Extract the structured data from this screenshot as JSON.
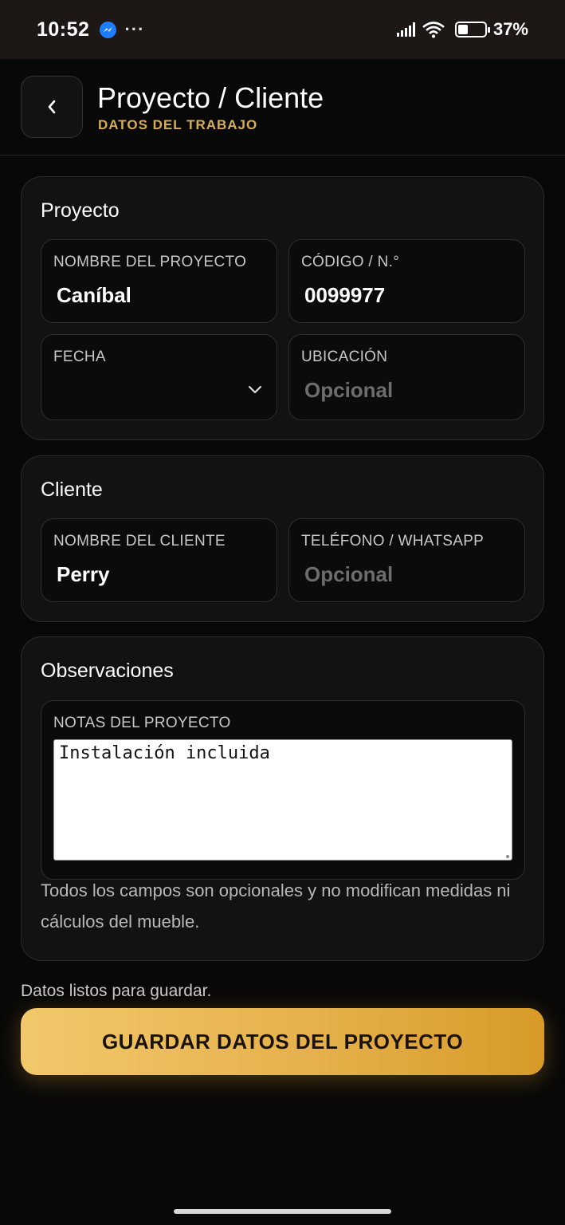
{
  "status_bar": {
    "time": "10:52",
    "battery_text": "37%",
    "battery_level": 0.37,
    "icons": [
      "messenger-icon",
      "more-dots-icon",
      "signal-icon",
      "wifi-icon",
      "battery-icon"
    ]
  },
  "header": {
    "title": "Proyecto / Cliente",
    "subtitle": "DATOS DEL TRABAJO",
    "back_icon": "chevron-left-icon"
  },
  "proyecto": {
    "section_title": "Proyecto",
    "nombre": {
      "label": "NOMBRE DEL PROYECTO",
      "value": "Caníbal"
    },
    "codigo": {
      "label": "CÓDIGO / N.°",
      "value": "0099977"
    },
    "fecha": {
      "label": "FECHA",
      "value": ""
    },
    "ubicacion": {
      "label": "UBICACIÓN",
      "placeholder": "Opcional"
    }
  },
  "cliente": {
    "section_title": "Cliente",
    "nombre": {
      "label": "NOMBRE DEL CLIENTE",
      "value": "Perry"
    },
    "telefono": {
      "label": "TELÉFONO / WHATSAPP",
      "placeholder": "Opcional"
    }
  },
  "observaciones": {
    "section_title": "Observaciones",
    "notas": {
      "label": "NOTAS DEL PROYECTO",
      "value": "Instalación incluida"
    },
    "helper": "Todos los campos son opcionales y no modifican medidas ni cálculos del mueble."
  },
  "footer": {
    "status": "Datos listos para guardar.",
    "save_label": "GUARDAR DATOS DEL PROYECTO"
  },
  "colors": {
    "accent_gold": "#d7ae55",
    "button_gradient_start": "#f1c86b",
    "button_gradient_end": "#d79a28",
    "background": "#080808",
    "card": "#121212"
  }
}
